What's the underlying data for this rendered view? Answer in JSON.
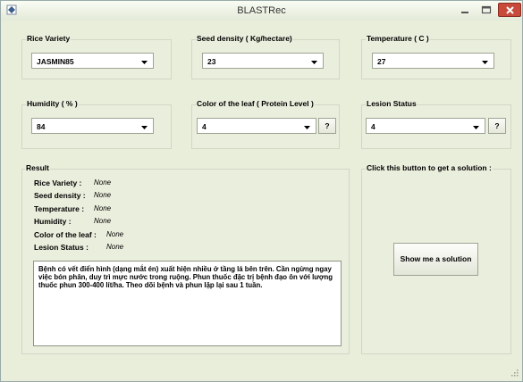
{
  "window": {
    "title": "BLASTRec"
  },
  "rice_variety": {
    "label": "Rice Variety",
    "value": "JASMIN85"
  },
  "seed_density": {
    "label": "Seed density ( Kg/hectare)",
    "value": "23"
  },
  "temperature": {
    "label": "Temperature ( C )",
    "value": "27"
  },
  "humidity": {
    "label": "Humidity ( % )",
    "value": "84"
  },
  "leaf_color": {
    "label": "Color of the leaf ( Protein Level )",
    "value": "4",
    "help_label": "?"
  },
  "lesion_status": {
    "label": "Lesion Status",
    "value": "4",
    "help_label": "?"
  },
  "result": {
    "label": "Result",
    "rows": [
      {
        "key": "Rice Variety :",
        "value": "None"
      },
      {
        "key": "Seed density :",
        "value": "None"
      },
      {
        "key": "Temperature :",
        "value": "None"
      },
      {
        "key": "Humidity :",
        "value": "None"
      },
      {
        "key": "Color of the leaf :",
        "value": "None"
      },
      {
        "key": "Lesion Status :",
        "value": "None"
      }
    ],
    "text": "Bệnh có vết điển hình (dạng mắt én) xuất hiện nhiều ở tầng lá bên trên. Cần ngừng ngay việc bón phân, duy trì mực nước trong ruộng. Phun thuốc đặc trị bệnh đạo ôn với lượng thuốc phun 300-400 lít/ha. Theo dõi bệnh và phun lặp lại sau 1 tuần."
  },
  "solution": {
    "label": "Click this button to get a solution :",
    "button_label": "Show me a solution"
  }
}
